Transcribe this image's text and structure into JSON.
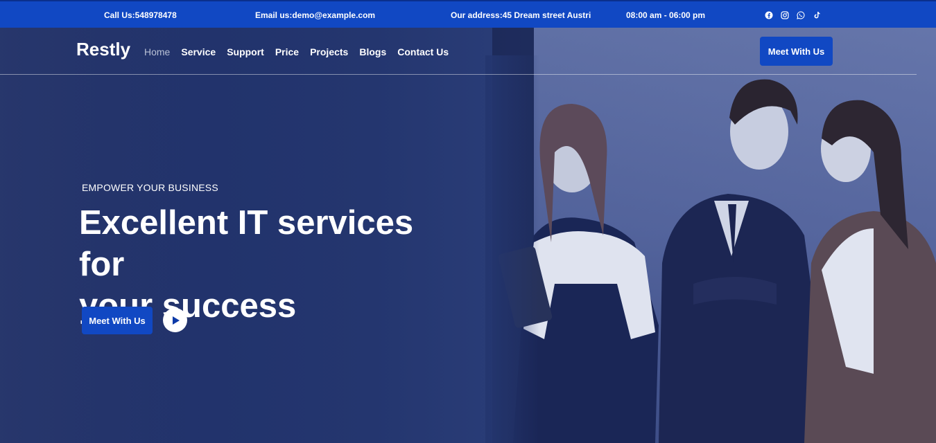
{
  "topbar": {
    "phone": "Call Us:548978478",
    "email": "Email us:demo@example.com",
    "address": "Our address:45 Dream street Austri",
    "hours": "08:00 am - 06:00 pm",
    "social_icons": [
      "facebook-icon",
      "instagram-icon",
      "whatsapp-icon",
      "tiktok-icon"
    ]
  },
  "nav": {
    "logo": "Restly",
    "items": [
      "Home",
      "Service",
      "Support",
      "Price",
      "Projects",
      "Blogs",
      "Contact Us"
    ],
    "active": "Home",
    "button": "Meet With Us"
  },
  "hero": {
    "eyebrow": "EMPOWER YOUR BUSINESS",
    "headline_line1": "Excellent IT services for",
    "headline_line2": "your success",
    "cta": "Meet With Us",
    "play_icon": "play-icon"
  },
  "colors": {
    "primary": "#1148c3",
    "overlay": "#1f2f68",
    "text": "#ffffff"
  }
}
